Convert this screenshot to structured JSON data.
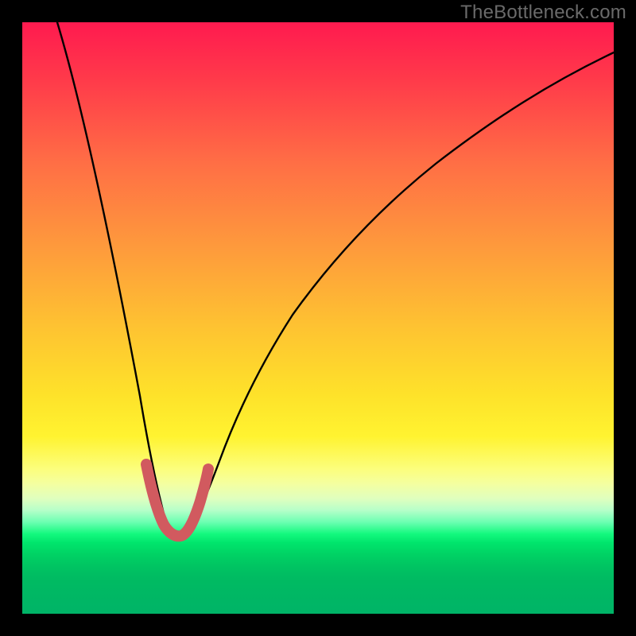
{
  "watermark": "TheBottleneck.com",
  "colors": {
    "frame": "#000000",
    "gradient_top": "#ff1a4f",
    "gradient_bottom": "#00b467",
    "curve": "#000000",
    "highlight": "#d15a5f"
  },
  "chart_data": {
    "type": "line",
    "title": "",
    "xlabel": "",
    "ylabel": "",
    "xlim": [
      0,
      100
    ],
    "ylim": [
      0,
      100
    ],
    "grid": false,
    "legend": false,
    "series": [
      {
        "name": "bottleneck_curve",
        "x": [
          6,
          8,
          10,
          12,
          14,
          16,
          18,
          20,
          22,
          23.7,
          25.5,
          27.5,
          29.5,
          32,
          36,
          40,
          45,
          50,
          55,
          60,
          65,
          70,
          75,
          80,
          85,
          90,
          95,
          100
        ],
        "y": [
          100,
          90,
          80,
          70,
          60,
          50,
          41,
          32,
          22,
          14,
          13,
          14,
          18,
          24,
          33,
          41,
          49,
          56,
          62,
          67,
          71,
          74.5,
          77.5,
          80,
          82,
          84,
          85.5,
          87
        ]
      },
      {
        "name": "highlight_segment",
        "x": [
          20.5,
          21.5,
          22.5,
          23.5,
          24.5,
          25.5,
          26.5,
          27.5,
          28.5,
          29.2
        ],
        "y": [
          27,
          21,
          16,
          13.5,
          13,
          13.5,
          14.5,
          17,
          21,
          26
        ]
      }
    ]
  }
}
